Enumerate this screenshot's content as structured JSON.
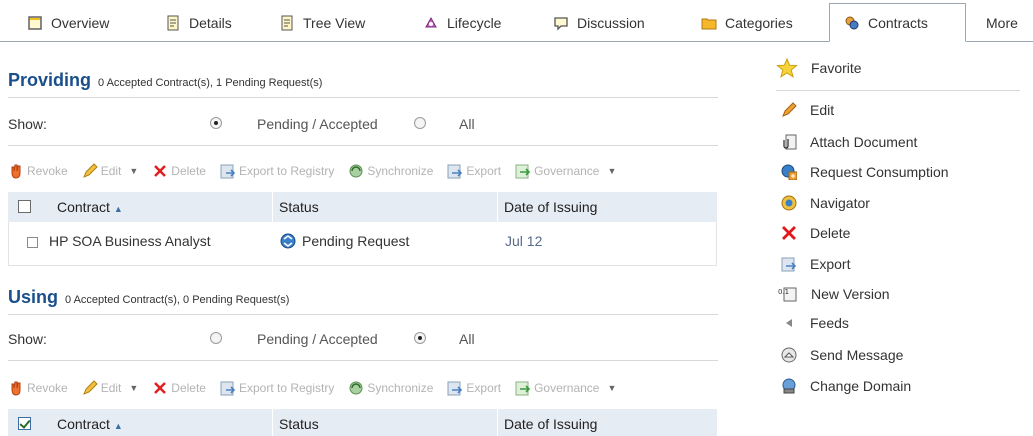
{
  "tabs": [
    {
      "label": "Overview",
      "icon": "overview-icon"
    },
    {
      "label": "Details",
      "icon": "details-icon"
    },
    {
      "label": "Tree View",
      "icon": "tree-view-icon"
    },
    {
      "label": "Lifecycle",
      "icon": "lifecycle-icon"
    },
    {
      "label": "Discussion",
      "icon": "discussion-icon"
    },
    {
      "label": "Categories",
      "icon": "folder-icon"
    },
    {
      "label": "Contracts",
      "icon": "contracts-icon",
      "active": true
    },
    {
      "label": "More",
      "icon": ""
    }
  ],
  "providing": {
    "title": "Providing",
    "summary": "0 Accepted Contract(s), 1 Pending Request(s)",
    "show_label": "Show:",
    "opt_pending": "Pending / Accepted",
    "opt_all": "All",
    "selected": "pending",
    "toolbar": [
      "Revoke",
      "Edit",
      "Delete",
      "Export to Registry",
      "Synchronize",
      "Export",
      "Governance"
    ],
    "columns": [
      "Contract",
      "Status",
      "Date of Issuing"
    ],
    "rows": [
      {
        "contract": "HP SOA Business Analyst",
        "status": "Pending Request",
        "date": "Jul 12"
      }
    ]
  },
  "using": {
    "title": "Using",
    "summary": "0 Accepted Contract(s), 0 Pending Request(s)",
    "show_label": "Show:",
    "opt_pending": "Pending / Accepted",
    "opt_all": "All",
    "selected": "all",
    "toolbar": [
      "Revoke",
      "Edit",
      "Delete",
      "Export to Registry",
      "Synchronize",
      "Export",
      "Governance"
    ],
    "columns": [
      "Contract",
      "Status",
      "Date of Issuing"
    ],
    "header_checked": true
  },
  "actions": [
    {
      "label": "Favorite",
      "icon": "star-icon"
    },
    {
      "label": "Edit",
      "icon": "pencil-icon"
    },
    {
      "label": "Attach Document",
      "icon": "attach-document-icon"
    },
    {
      "label": "Request Consumption",
      "icon": "request-consumption-icon"
    },
    {
      "label": "Navigator",
      "icon": "navigator-icon"
    },
    {
      "label": "Delete",
      "icon": "delete-x-icon"
    },
    {
      "label": "Export",
      "icon": "export-icon"
    },
    {
      "label": "New Version",
      "icon": "new-version-icon"
    },
    {
      "label": "Feeds",
      "icon": "feeds-icon"
    },
    {
      "label": "Send Message",
      "icon": "send-message-icon"
    },
    {
      "label": "Change Domain",
      "icon": "change-domain-icon"
    }
  ],
  "colors": {
    "heading": "#1a4f8b",
    "table_header": "#e6ecf4",
    "disabled_text": "#b3b3b3"
  }
}
